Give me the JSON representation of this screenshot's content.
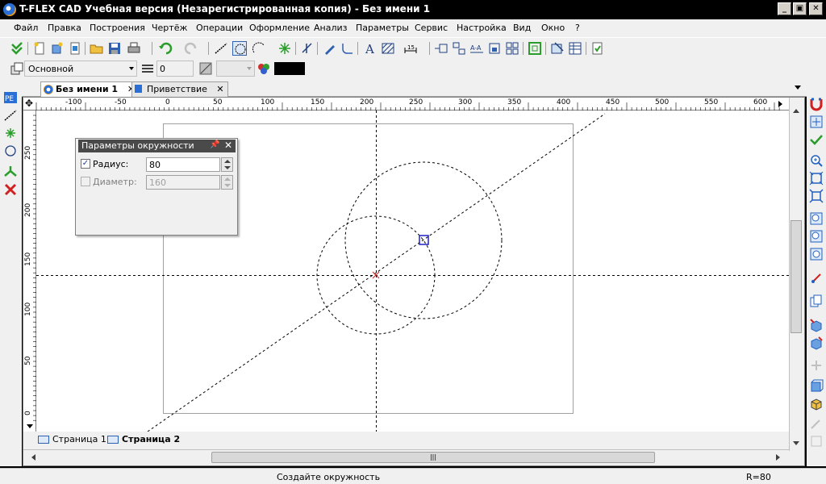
{
  "window": {
    "title": "T-FLEX CAD Учебная версия (Незарегистрированная копия) - Без имени 1"
  },
  "menu": [
    "Файл",
    "Правка",
    "Построения",
    "Чертёж",
    "Операции",
    "Оформление",
    "Анализ",
    "Параметры",
    "Сервис",
    "Настройка",
    "Вид",
    "Окно",
    "?"
  ],
  "toolbar2": {
    "layer": "Основной",
    "level": "0"
  },
  "doc_tabs": [
    {
      "label": "Без имени 1",
      "active": true
    },
    {
      "label": "Приветствие",
      "active": false
    }
  ],
  "ruler": {
    "h_labels": [
      "-100",
      "-50",
      "0",
      "50",
      "100",
      "150",
      "200",
      "250",
      "300",
      "350",
      "400",
      "450",
      "500",
      "550",
      "600"
    ],
    "v_labels": [
      "250",
      "200",
      "150",
      "100",
      "50",
      "0"
    ]
  },
  "panel": {
    "title": "Параметры окружности",
    "radius_label": "Радиус:",
    "radius_value": "80",
    "radius_checked": true,
    "diameter_label": "Диаметр:",
    "diameter_value": "160",
    "diameter_checked": false
  },
  "page_tabs": [
    {
      "label": "Страница 1",
      "active": false
    },
    {
      "label": "Страница 2",
      "active": true
    }
  ],
  "status": {
    "message": "Создайте окружность",
    "value": "R=80"
  },
  "colors": {
    "accent": "#2a6fd6",
    "snap_marker": "#2020c0",
    "center_marker": "#d02020"
  }
}
